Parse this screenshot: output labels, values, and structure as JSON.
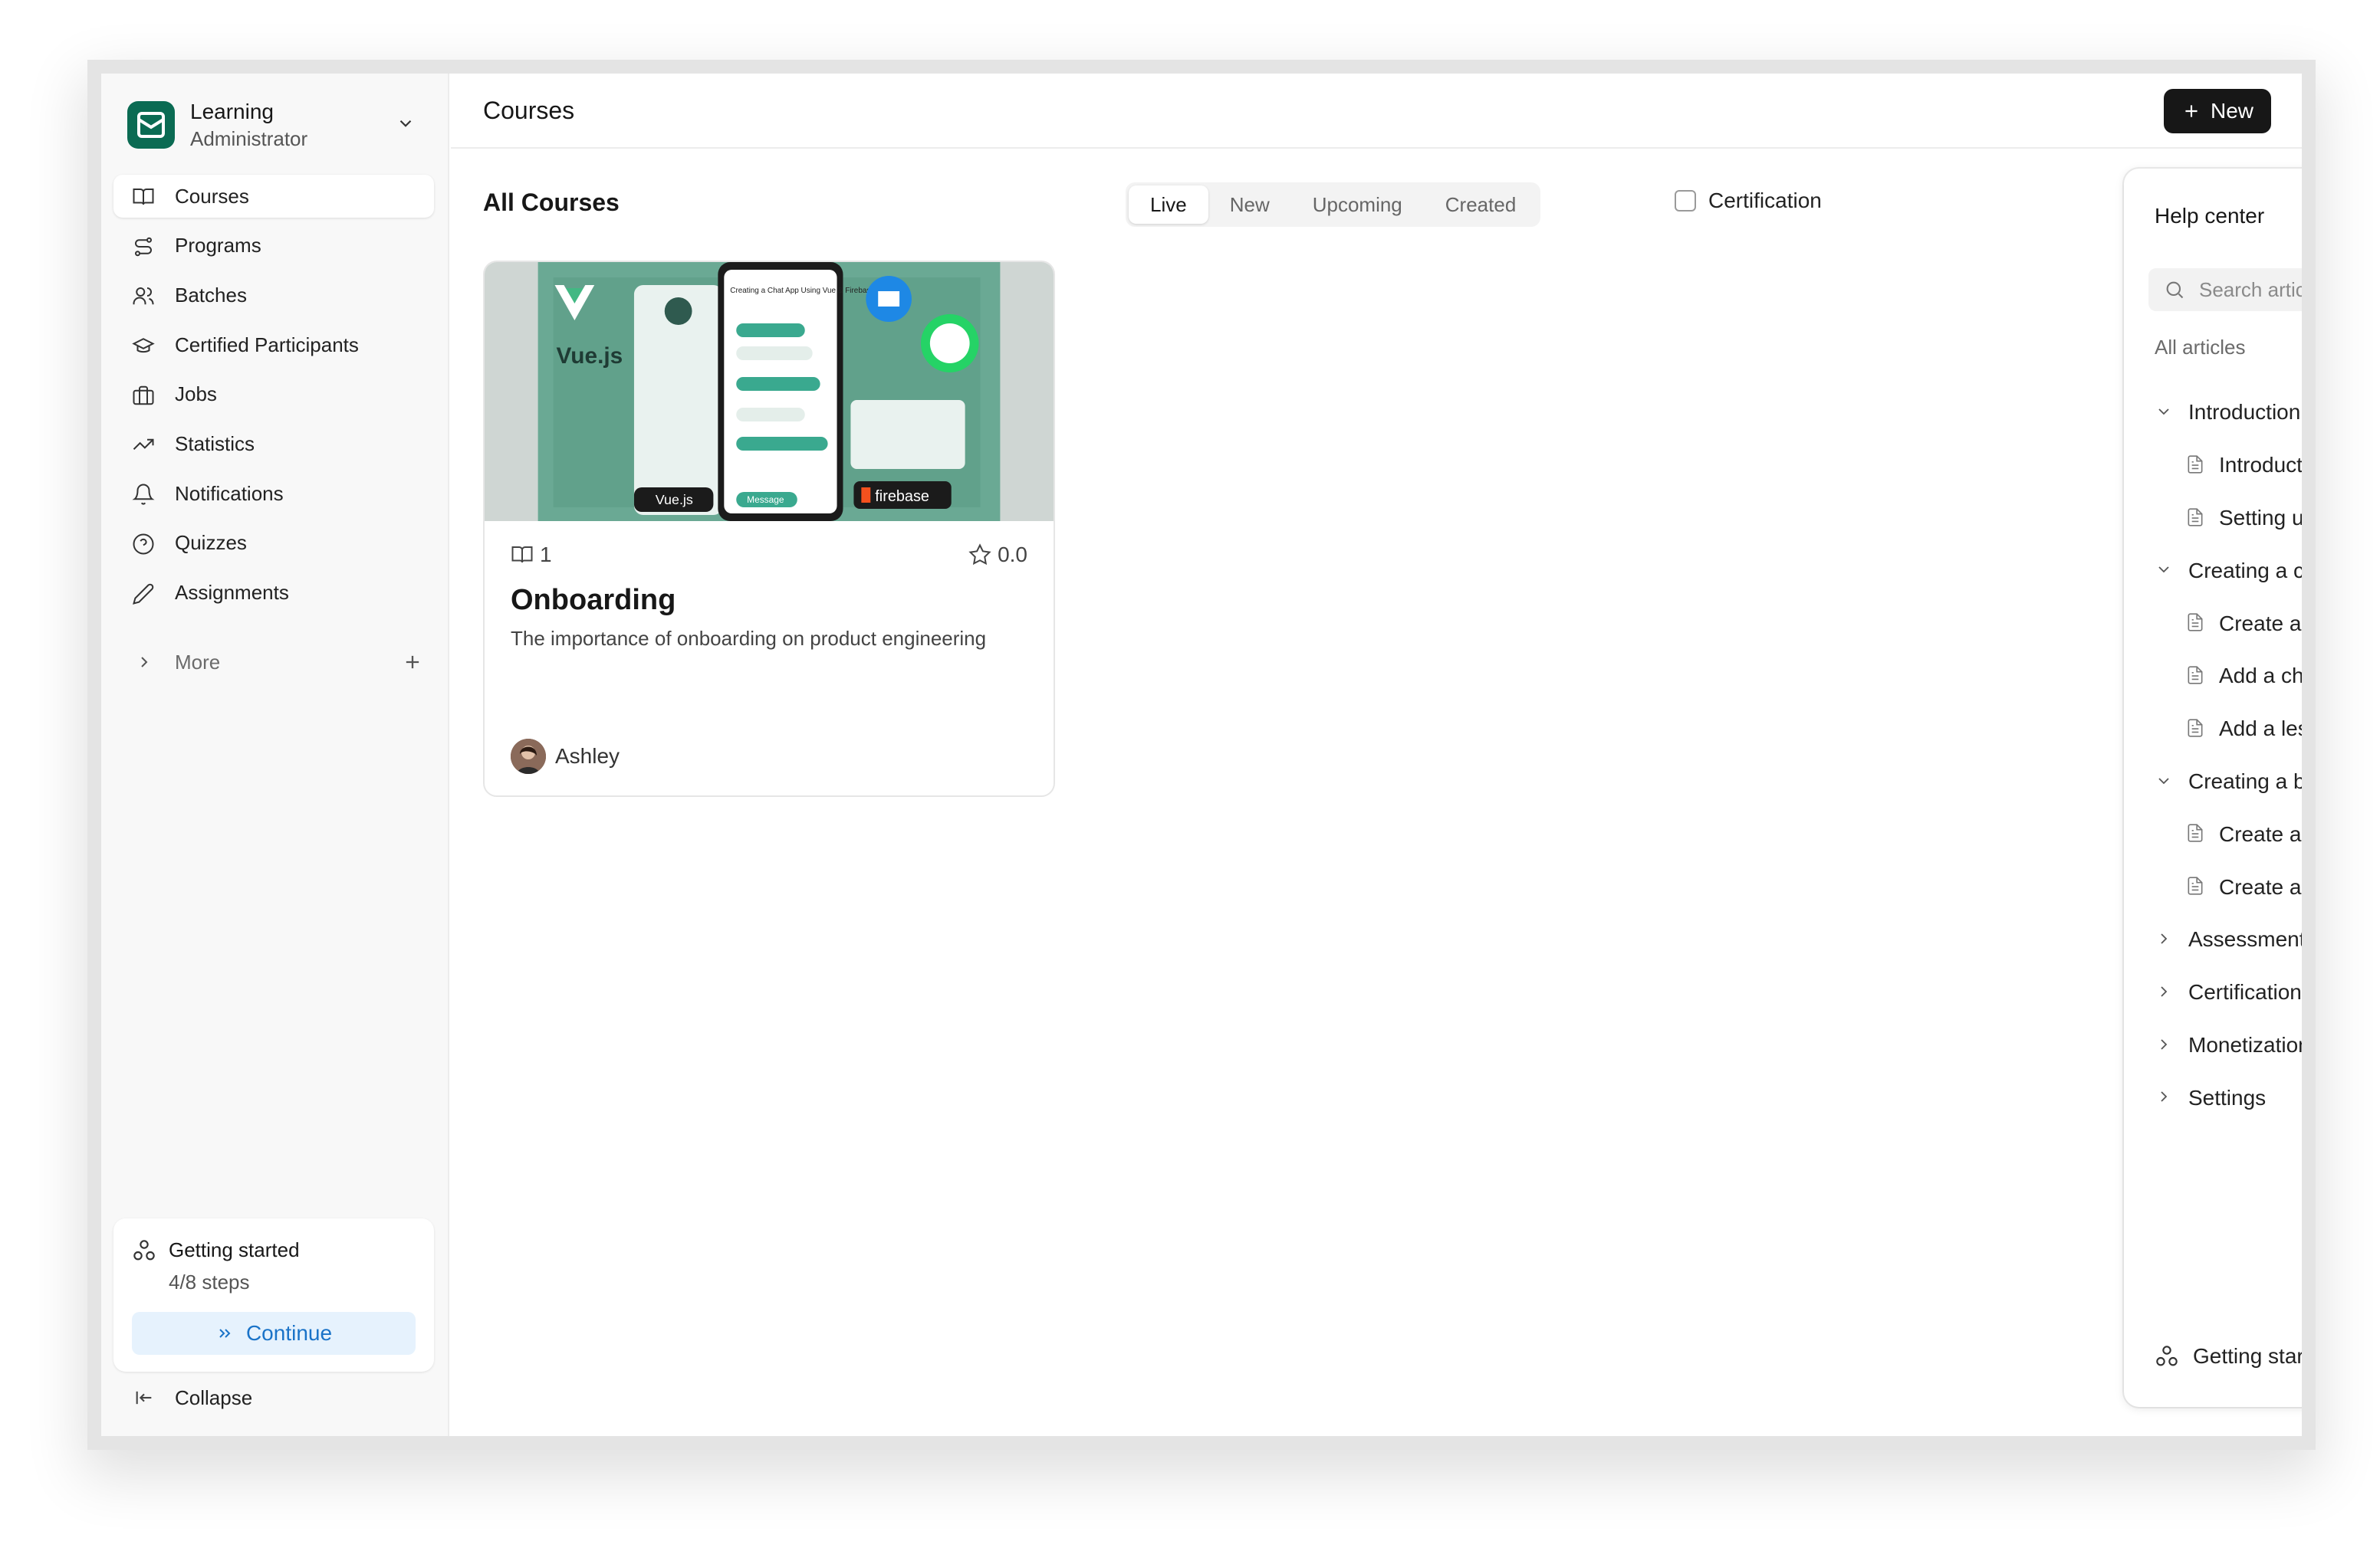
{
  "app": {
    "name": "Learning",
    "role": "Administrator"
  },
  "sidebar": {
    "items": [
      {
        "label": "Courses",
        "icon": "book-open-icon",
        "active": true
      },
      {
        "label": "Programs",
        "icon": "route-icon"
      },
      {
        "label": "Batches",
        "icon": "users-icon"
      },
      {
        "label": "Certified Participants",
        "icon": "graduation-cap-icon"
      },
      {
        "label": "Jobs",
        "icon": "briefcase-icon"
      },
      {
        "label": "Statistics",
        "icon": "trending-up-icon"
      },
      {
        "label": "Notifications",
        "icon": "bell-icon"
      },
      {
        "label": "Quizzes",
        "icon": "help-circle-icon"
      },
      {
        "label": "Assignments",
        "icon": "pencil-icon"
      }
    ],
    "more_label": "More",
    "getting_started": {
      "title": "Getting started",
      "steps": "4/8 steps",
      "button": "Continue"
    },
    "collapse_label": "Collapse"
  },
  "header": {
    "title": "Courses",
    "new_label": "New"
  },
  "main": {
    "section_title": "All Courses",
    "tabs": [
      {
        "label": "Live",
        "active": true
      },
      {
        "label": "New"
      },
      {
        "label": "Upcoming"
      },
      {
        "label": "Created"
      }
    ],
    "certification_filter": {
      "label": "Certification",
      "checked": false
    }
  },
  "courses": [
    {
      "lessons": "1",
      "rating": "0.0",
      "title": "Onboarding",
      "description": "The importance of onboarding on product engineering",
      "author": "Ashley",
      "thumbnail_text": {
        "vue": "Vue.js",
        "vue_badge": "Vue.js",
        "message": "Message",
        "firebase": "firebase",
        "chat_title": "Creating a Chat App Using Vue & Firebase"
      }
    }
  ],
  "help_center": {
    "title": "Help center",
    "search_placeholder": "Search articles...",
    "all_articles": "All articles",
    "sections": [
      {
        "label": "Introduction",
        "expanded": true,
        "articles": [
          "Introduction",
          "Setting up"
        ]
      },
      {
        "label": "Creating a course",
        "expanded": true,
        "articles": [
          "Create a course",
          "Add a chapter",
          "Add a lesson"
        ]
      },
      {
        "label": "Creating a batch",
        "expanded": true,
        "articles": [
          "Create a batch",
          "Create a live class"
        ]
      },
      {
        "label": "Assessments",
        "expanded": false,
        "articles": []
      },
      {
        "label": "Certification",
        "expanded": false,
        "articles": []
      },
      {
        "label": "Monetization",
        "expanded": false,
        "articles": []
      },
      {
        "label": "Settings",
        "expanded": false,
        "articles": []
      }
    ],
    "footer_label": "Getting started"
  },
  "colors": {
    "brand": "#0b6b53",
    "primary_button": "#171717",
    "continue_bg": "#e6f2fd",
    "continue_text": "#1a73c8"
  }
}
